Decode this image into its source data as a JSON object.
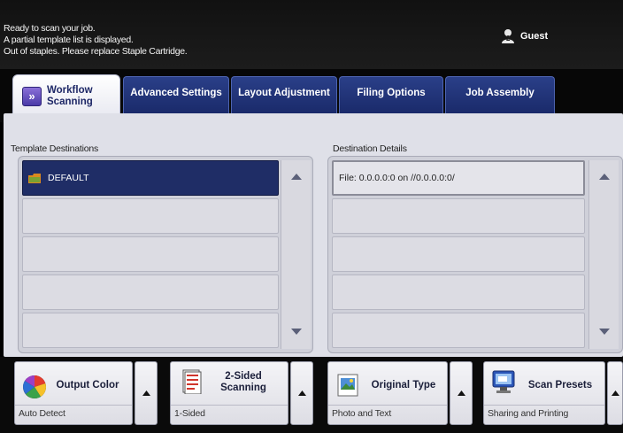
{
  "status": {
    "messages": [
      "Ready to scan your job.",
      "A partial template list is displayed.",
      "Out of staples. Please replace Staple Cartridge."
    ],
    "user": "Guest"
  },
  "tabs": [
    {
      "label": "Workflow Scanning",
      "line1": "Workflow",
      "line2": "Scanning",
      "active": true,
      "icon": "workflow-scan-icon"
    },
    {
      "label": "Advanced Settings"
    },
    {
      "label": "Layout Adjustment"
    },
    {
      "label": "Filing Options"
    },
    {
      "label": "Job Assembly"
    }
  ],
  "templates": {
    "heading": "Template Destinations",
    "items": [
      {
        "label": "DEFAULT",
        "icon": "template-folder-icon",
        "selected": true
      },
      {
        "label": ""
      },
      {
        "label": ""
      },
      {
        "label": ""
      },
      {
        "label": ""
      }
    ]
  },
  "details": {
    "heading": "Destination Details",
    "items": [
      {
        "label": "File: 0.0.0.0:0 on //0.0.0.0:0/"
      },
      {
        "label": ""
      },
      {
        "label": ""
      },
      {
        "label": ""
      },
      {
        "label": ""
      }
    ]
  },
  "features": [
    {
      "title": "Output Color",
      "value": "Auto Detect",
      "icon": "color-wheel-icon"
    },
    {
      "title_line1": "2-Sided",
      "title_line2": "Scanning",
      "value": "1-Sided",
      "icon": "duplex-page-icon"
    },
    {
      "title": "Original Type",
      "value": "Photo and Text",
      "icon": "photo-document-icon"
    },
    {
      "title": "Scan Presets",
      "value": "Sharing and Printing",
      "icon": "monitor-preset-icon"
    }
  ],
  "colors": {
    "accent": "#1f2d66",
    "tab_bg": "#22377d",
    "panel": "#dfe0e8"
  }
}
